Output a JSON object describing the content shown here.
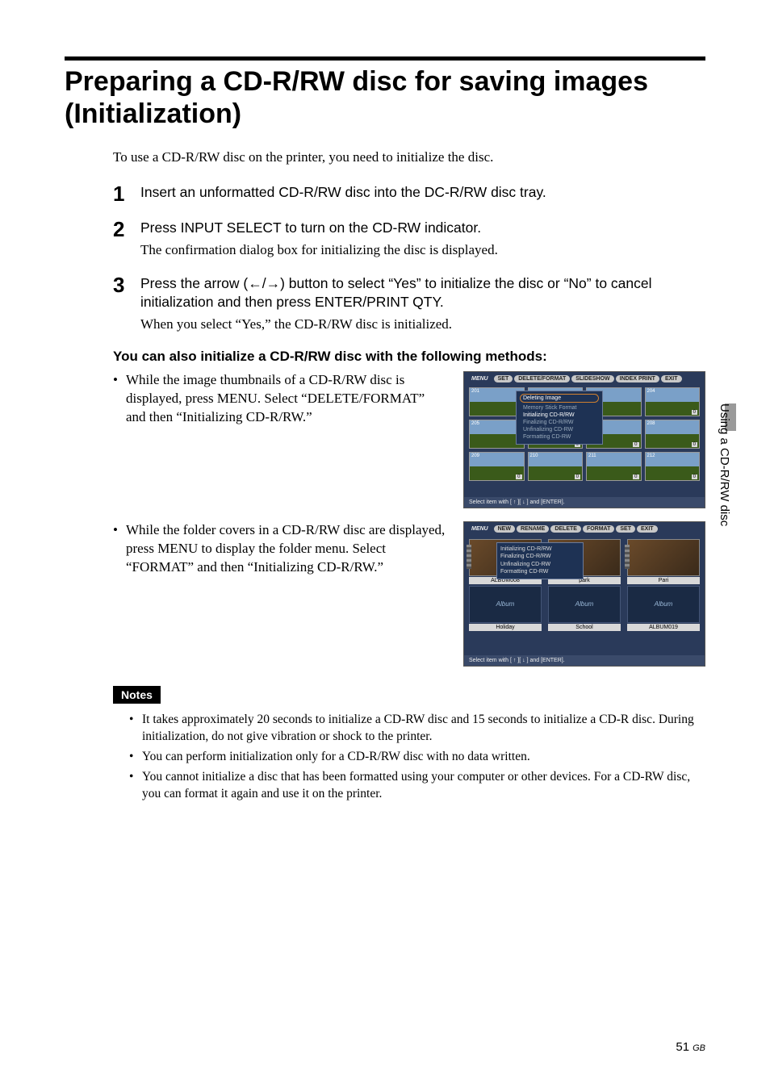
{
  "title": "Preparing a CD-R/RW disc for saving images (Initialization)",
  "intro": "To use a CD-R/RW disc on the printer, you need to initialize the disc.",
  "steps": [
    {
      "num": "1",
      "head": "Insert an unformatted CD-R/RW disc into the DC-R/RW disc tray.",
      "sub": ""
    },
    {
      "num": "2",
      "head": "Press INPUT SELECT to turn on the CD-RW indicator.",
      "sub": "The confirmation dialog box for initializing the disc is displayed."
    },
    {
      "num": "3",
      "head": "Press the arrow (←/→) button to select “Yes” to initialize the disc or “No” to cancel initialization and then press ENTER/PRINT QTY.",
      "sub": "When you select “Yes,” the CD-R/RW disc is initialized."
    }
  ],
  "subhead": "You can also initialize a CD-R/RW disc with the following methods:",
  "method1": "While the image thumbnails of a CD-R/RW disc is displayed, press MENU.  Select “DELETE/FORMAT” and then “Initializing CD-R/RW.”",
  "method2": "While the folder covers in a CD-R/RW disc are displayed, press MENU to display the folder menu.  Select “FORMAT” and then “Initializing CD-R/RW.”",
  "screenshot1": {
    "tabs": [
      "MENU",
      "SET",
      "DELETE/FORMAT",
      "SLIDESHOW",
      "INDEX PRINT",
      "EXIT"
    ],
    "dropdown": {
      "highlight": "Deleting Image",
      "opts": [
        "Memory Stick Format",
        "Initializing CD-R/RW",
        "Finalizing CD-R/RW",
        "Unfinalizing CD-RW",
        "Formatting CD-RW"
      ]
    },
    "thumbs": [
      "201",
      "",
      "",
      "204",
      "205",
      "",
      "",
      "208",
      "209",
      "210",
      "211",
      "212"
    ],
    "status": "Select item with [ ↑ ][ ↓ ] and [ENTER]."
  },
  "screenshot2": {
    "tabs": [
      "MENU",
      "NEW",
      "RENAME",
      "DELETE",
      "FORMAT",
      "SET",
      "EXIT"
    ],
    "dropdown": {
      "highlight": "Initializing CD-R/RW",
      "opts": [
        "Finalizing CD-R/RW",
        "Unfinalizing CD-RW",
        "Formatting CD-RW"
      ]
    },
    "row1_labels": [
      "ALBUM008",
      "park",
      "Pari"
    ],
    "row2_placeholder": "Album",
    "row2_labels": [
      "Holiday",
      "School",
      "ALBUM019"
    ],
    "status": "Select item with [ ↑ ][ ↓ ] and [ENTER]."
  },
  "notes_label": "Notes",
  "notes": [
    "It takes approximately 20 seconds to initialize a CD-RW disc and 15 seconds to initialize a CD-R disc.  During initialization, do not give vibration or shock to the printer.",
    "You can perform initialization only for a CD-R/RW disc with no data written.",
    "You cannot initialize a disc that has been formatted using your computer or other devices.  For a CD-RW disc, you can format it again and use it on the printer."
  ],
  "side_tab": "Using a CD-R/RW disc",
  "page_number": "51",
  "page_region": "GB"
}
